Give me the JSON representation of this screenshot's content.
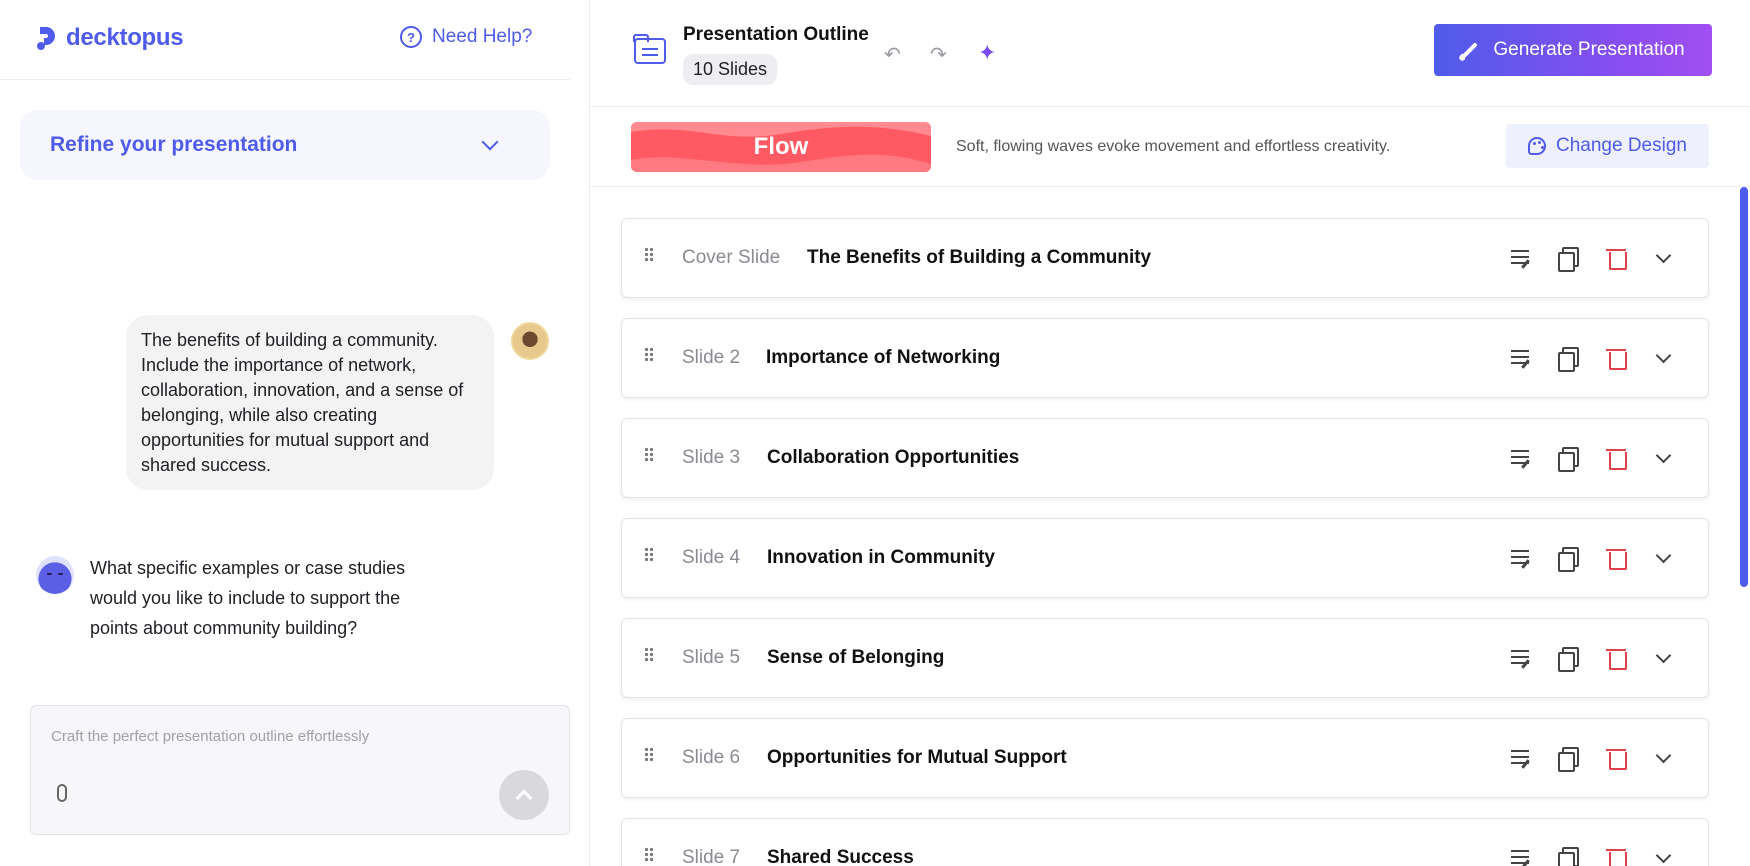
{
  "brand": {
    "name": "decktopus",
    "accent": "#4f5bea"
  },
  "help": {
    "label": "Need Help?",
    "icon": "question-circle-icon"
  },
  "refine": {
    "label": "Refine your presentation"
  },
  "chat": {
    "user_message": "The benefits of building a community. Include the importance of network, collaboration, innovation, and a sense of belonging, while also creating opportunities for mutual support and shared success.",
    "bot_message": "What specific examples or case studies would you like to include to support the points about community building?"
  },
  "composer": {
    "placeholder": "Craft the perfect presentation outline effortlessly"
  },
  "outline": {
    "title": "Presentation Outline",
    "slide_count": "10 Slides"
  },
  "toolbar": {
    "undo_icon": "↶",
    "redo_icon": "↷",
    "sparkle_icon": "✦",
    "generate_label": "Generate Presentation"
  },
  "design": {
    "name": "Flow",
    "description": "Soft, flowing waves evoke movement and effortless creativity.",
    "change_label": "Change Design",
    "thumb_color": "#ff5a63"
  },
  "slides": [
    {
      "num": "Cover Slide",
      "title": "The Benefits of Building a Community"
    },
    {
      "num": "Slide 2",
      "title": "Importance of Networking"
    },
    {
      "num": "Slide 3",
      "title": "Collaboration Opportunities"
    },
    {
      "num": "Slide 4",
      "title": "Innovation in Community"
    },
    {
      "num": "Slide 5",
      "title": "Sense of Belonging"
    },
    {
      "num": "Slide 6",
      "title": "Opportunities for Mutual Support"
    },
    {
      "num": "Slide 7",
      "title": "Shared Success"
    }
  ]
}
